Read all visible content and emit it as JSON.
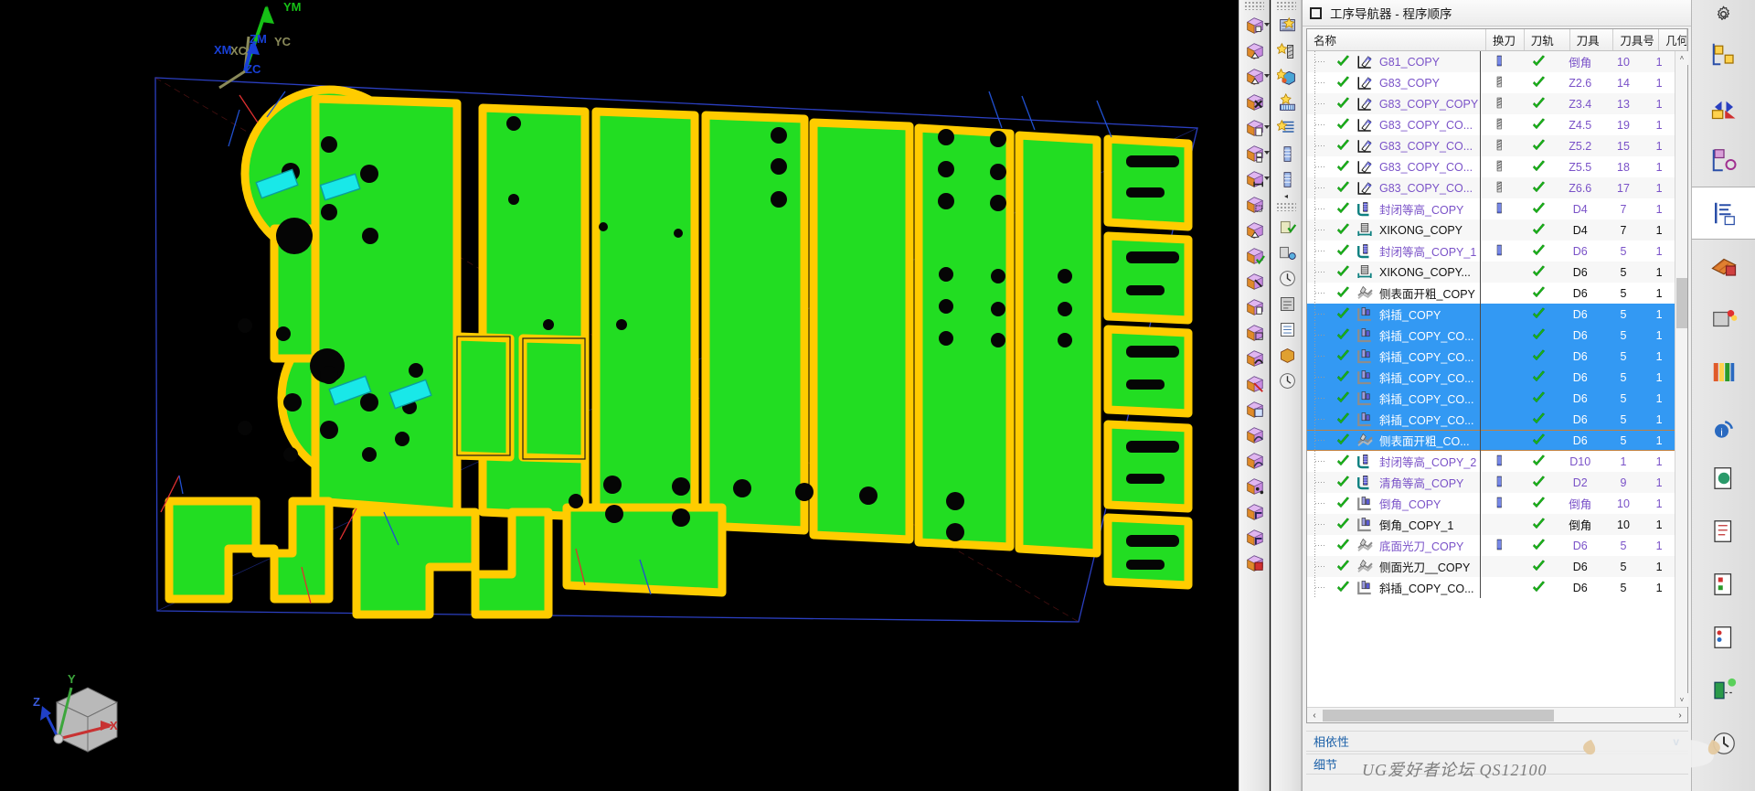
{
  "navigator": {
    "title": "工序导航器 - 程序顺序",
    "gear_icon": "gear-icon",
    "columns": [
      {
        "key": "name",
        "label": "名称"
      },
      {
        "key": "tc",
        "label": "换刀"
      },
      {
        "key": "path",
        "label": "刀轨"
      },
      {
        "key": "tool",
        "label": "刀具"
      },
      {
        "key": "tnum",
        "label": "刀具号"
      },
      {
        "key": "geo",
        "label": "几何.."
      }
    ],
    "rows": [
      {
        "name": "G81_COPY",
        "icon": "drill-op-icon",
        "purple": true,
        "toolchange": "blue-stack",
        "path": true,
        "tool": "倒角",
        "tnum": "10",
        "geo": "1",
        "selected": false
      },
      {
        "name": "G83_COPY",
        "icon": "drill-op-icon",
        "purple": true,
        "toolchange": "drill-bit",
        "path": true,
        "tool": "Z2.6",
        "tnum": "14",
        "geo": "1",
        "selected": false
      },
      {
        "name": "G83_COPY_COPY",
        "icon": "drill-op-icon",
        "purple": true,
        "toolchange": "drill-bit",
        "path": true,
        "tool": "Z3.4",
        "tnum": "13",
        "geo": "1",
        "selected": false
      },
      {
        "name": "G83_COPY_CO...",
        "icon": "drill-op-icon",
        "purple": true,
        "toolchange": "drill-bit",
        "path": true,
        "tool": "Z4.5",
        "tnum": "19",
        "geo": "1",
        "selected": false
      },
      {
        "name": "G83_COPY_CO...",
        "icon": "drill-op-icon",
        "purple": true,
        "toolchange": "drill-bit",
        "path": true,
        "tool": "Z5.2",
        "tnum": "15",
        "geo": "1",
        "selected": false
      },
      {
        "name": "G83_COPY_CO...",
        "icon": "drill-op-icon",
        "purple": true,
        "toolchange": "drill-bit",
        "path": true,
        "tool": "Z5.5",
        "tnum": "18",
        "geo": "1",
        "selected": false
      },
      {
        "name": "G83_COPY_CO...",
        "icon": "drill-op-icon",
        "purple": true,
        "toolchange": "drill-bit",
        "path": true,
        "tool": "Z6.6",
        "tnum": "17",
        "geo": "1",
        "selected": false
      },
      {
        "name": "封闭等高_COPY",
        "icon": "contour-op-icon",
        "purple": true,
        "toolchange": "blue-stack",
        "path": true,
        "tool": "D4",
        "tnum": "7",
        "geo": "1",
        "selected": false
      },
      {
        "name": "XIKONG_COPY",
        "icon": "xikong-op-icon",
        "purple": false,
        "toolchange": "",
        "path": true,
        "tool": "D4",
        "tnum": "7",
        "geo": "1",
        "selected": false
      },
      {
        "name": "封闭等高_COPY_1",
        "icon": "contour-op-icon",
        "purple": true,
        "toolchange": "blue-stack",
        "path": true,
        "tool": "D6",
        "tnum": "5",
        "geo": "1",
        "selected": false
      },
      {
        "name": "XIKONG_COPY...",
        "icon": "xikong-op-icon",
        "purple": false,
        "toolchange": "",
        "path": true,
        "tool": "D6",
        "tnum": "5",
        "geo": "1",
        "selected": false
      },
      {
        "name": "侧表面开粗_COPY",
        "icon": "surface-op-icon",
        "purple": false,
        "toolchange": "",
        "path": true,
        "tool": "D6",
        "tnum": "5",
        "geo": "1",
        "selected": false
      },
      {
        "name": "斜插_COPY",
        "icon": "zlevel-op-icon",
        "purple": true,
        "toolchange": "",
        "path": true,
        "tool": "D6",
        "tnum": "5",
        "geo": "1",
        "selected": true
      },
      {
        "name": "斜插_COPY_CO...",
        "icon": "zlevel-op-icon",
        "purple": true,
        "toolchange": "",
        "path": true,
        "tool": "D6",
        "tnum": "5",
        "geo": "1",
        "selected": true
      },
      {
        "name": "斜插_COPY_CO...",
        "icon": "zlevel-op-icon",
        "purple": true,
        "toolchange": "",
        "path": true,
        "tool": "D6",
        "tnum": "5",
        "geo": "1",
        "selected": true
      },
      {
        "name": "斜插_COPY_CO...",
        "icon": "zlevel-op-icon",
        "purple": true,
        "toolchange": "",
        "path": true,
        "tool": "D6",
        "tnum": "5",
        "geo": "1",
        "selected": true
      },
      {
        "name": "斜插_COPY_CO...",
        "icon": "zlevel-op-icon",
        "purple": true,
        "toolchange": "",
        "path": true,
        "tool": "D6",
        "tnum": "5",
        "geo": "1",
        "selected": true
      },
      {
        "name": "斜插_COPY_CO...",
        "icon": "zlevel-op-icon",
        "purple": true,
        "toolchange": "",
        "path": true,
        "tool": "D6",
        "tnum": "5",
        "geo": "1",
        "selected": true
      },
      {
        "name": "侧表面开粗_CO...",
        "icon": "surface-op-icon",
        "purple": true,
        "toolchange": "",
        "path": true,
        "tool": "D6",
        "tnum": "5",
        "geo": "1",
        "selected": true,
        "focus": true
      },
      {
        "name": "封闭等高_COPY_2",
        "icon": "contour-op-icon",
        "purple": true,
        "toolchange": "blue-stack",
        "path": true,
        "tool": "D10",
        "tnum": "1",
        "geo": "1",
        "selected": false
      },
      {
        "name": "清角等高_COPY",
        "icon": "contour-op-icon",
        "purple": true,
        "toolchange": "blue-stack",
        "path": true,
        "tool": "D2",
        "tnum": "9",
        "geo": "1",
        "selected": false
      },
      {
        "name": "倒角_COPY",
        "icon": "zlevel-op-icon",
        "purple": true,
        "toolchange": "blue-stack",
        "path": true,
        "tool": "倒角",
        "tnum": "10",
        "geo": "1",
        "selected": false
      },
      {
        "name": "倒角_COPY_1",
        "icon": "zlevel-op-icon",
        "purple": false,
        "toolchange": "",
        "path": true,
        "tool": "倒角",
        "tnum": "10",
        "geo": "1",
        "selected": false
      },
      {
        "name": "底面光刀_COPY",
        "icon": "surface-op-icon",
        "purple": true,
        "toolchange": "blue-stack",
        "path": true,
        "tool": "D6",
        "tnum": "5",
        "geo": "1",
        "selected": false
      },
      {
        "name": "侧面光刀__COPY",
        "icon": "surface-op-icon",
        "purple": false,
        "toolchange": "",
        "path": true,
        "tool": "D6",
        "tnum": "5",
        "geo": "1",
        "selected": false
      },
      {
        "name": "斜插_COPY_CO...",
        "icon": "zlevel-op-icon",
        "purple": false,
        "toolchange": "",
        "path": true,
        "tool": "D6",
        "tnum": "5",
        "geo": "1",
        "selected": false
      }
    ],
    "sections": [
      {
        "label": "相依性",
        "chevron": "v",
        "expanded": false
      },
      {
        "label": "细节",
        "chevron": "",
        "expanded": false
      }
    ],
    "scroll": {
      "up_glyph": "˄",
      "down_glyph": "˅",
      "left_glyph": "‹",
      "right_glyph": "›"
    }
  },
  "viewport": {
    "wcs": {
      "ym": "YM",
      "zm": "ZM",
      "xm": "XM",
      "yc": "YC",
      "zc": "ZC",
      "xc": "XC"
    },
    "triad": {
      "x": "X",
      "y": "Y",
      "z": "Z"
    },
    "colors": {
      "part_face": "#22dd22",
      "part_edge": "#ffcc00",
      "background": "#000000",
      "blueprint_box": "#2b3fc0",
      "selection_blue": "#3399f3"
    }
  },
  "watermark": {
    "text": "UG爱好者论坛 QS12100"
  },
  "center_toolbars": {
    "column1": [
      "move-object-icon",
      "cylinder-taper-icon",
      "extrude-taper-icon",
      "delete-face-icon",
      "copy-body-icon",
      "pattern-body-icon",
      "measure-body-icon",
      "resize-body-icon",
      "taper-body-icon",
      "edit-body-icon",
      "trim-body-icon",
      "offset-face-icon",
      "shell-body-icon",
      "blend-icon",
      "split-body-icon",
      "datum-plane-icon",
      "sketch-icon",
      "curve-icon",
      "point-set-icon",
      "wcs-icon",
      "coordinate-icon",
      "box-icon"
    ],
    "column2": [
      "floor-wall-mill-icon",
      "drill-op-icon",
      "cavity-mill-icon",
      "zlevel-profile-icon",
      "fixed-contour-icon",
      "variable-contour-icon",
      "flow-cut-icon",
      "verify-tool-path-icon",
      "tool-path-sim-icon",
      "gouge-check-icon",
      "post-process-icon",
      "shop-doc-icon",
      "machine-sim-icon",
      "clock-icon"
    ]
  },
  "resource_bar": {
    "gear_icon": "gear-icon",
    "items": [
      "assembly-navigator-icon",
      "part-navigator-icon",
      "reuse-library-icon",
      "operation-navigator-icon",
      "machine-tool-view-icon",
      "machining-feature-icon",
      "web-browser-icon",
      "help-icon",
      "history-icon",
      "system-materials-icon",
      "manufacturing-wizard-icon",
      "roles-icon",
      "system-scenes-icon",
      "process-studio-icon"
    ],
    "selected": "operation-navigator-icon"
  }
}
